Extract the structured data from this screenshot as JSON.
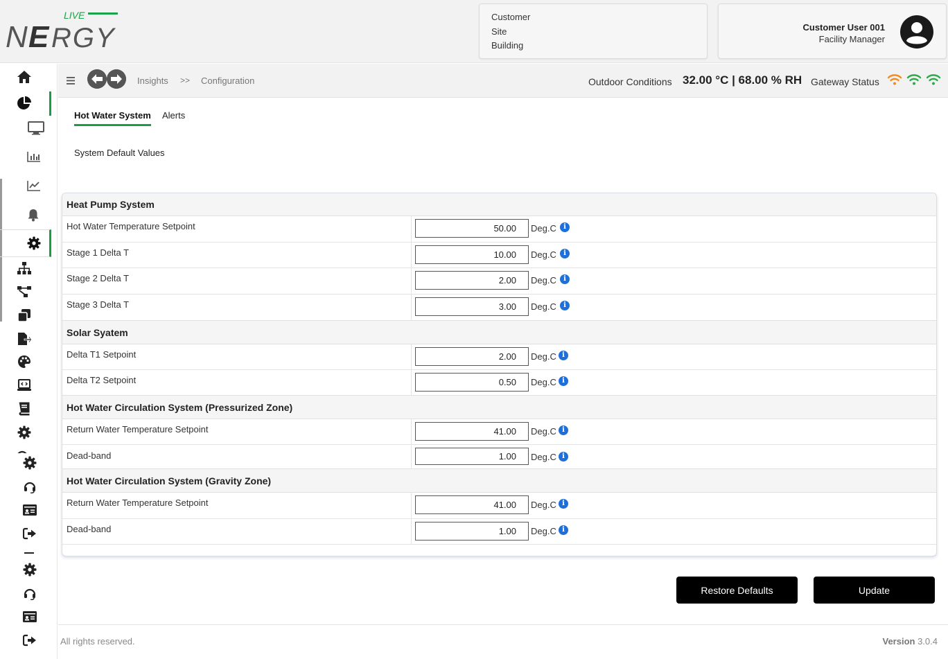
{
  "logo": {
    "main": "NERGY",
    "sup": "LIVE"
  },
  "location": {
    "customer": "Customer",
    "site": "Site",
    "building": "Building"
  },
  "user": {
    "name": "Customer User 001",
    "role": "Facility Manager"
  },
  "breadcrumb": {
    "first": "Insights",
    "separator": ">>",
    "second": "Configuration"
  },
  "outdoor": {
    "label": "Outdoor Conditions",
    "value": "32.00 °C | 68.00 % RH"
  },
  "gateway": {
    "label": "Gateway Status",
    "colors": [
      "#f28c1e",
      "#2bab4a",
      "#2bab4a"
    ]
  },
  "tabs": {
    "hot_water": "Hot Water System",
    "alerts": "Alerts"
  },
  "system_defaults_label": "System Default Values",
  "sections": [
    {
      "title": "Heat Pump System",
      "rows": [
        {
          "label": "Hot Water Temperature Setpoint",
          "value": "50.00",
          "unit": "Deg.C"
        },
        {
          "label": "Stage 1 Delta T",
          "value": "10.00",
          "unit": "Deg.C"
        },
        {
          "label": "Stage 2 Delta T",
          "value": "2.00",
          "unit": "Deg.C"
        },
        {
          "label": "Stage 3 Delta T",
          "value": "3.00",
          "unit": "Deg.C"
        }
      ]
    },
    {
      "title": "Solar Syatem",
      "rows": [
        {
          "label": "Delta T1 Setpoint",
          "value": "2.00",
          "unit": "Deg.C"
        },
        {
          "label": "Delta T2 Setpoint",
          "value": "0.50",
          "unit": "Deg.C"
        }
      ]
    },
    {
      "title": "Hot Water Circulation System (Pressurized Zone)",
      "rows": [
        {
          "label": "Return Water Temperature Setpoint",
          "value": "41.00",
          "unit": "Deg.C"
        },
        {
          "label": "Dead-band",
          "value": "1.00",
          "unit": "Deg.C"
        }
      ]
    },
    {
      "title": "Hot Water Circulation System (Gravity Zone)",
      "rows": [
        {
          "label": "Return Water Temperature Setpoint",
          "value": "41.00",
          "unit": "Deg.C"
        },
        {
          "label": "Dead-band",
          "value": "1.00",
          "unit": "Deg.C"
        }
      ]
    }
  ],
  "info_glyph": "i",
  "buttons": {
    "restore": "Restore Defaults",
    "update": "Update"
  },
  "footer": {
    "rights": "All rights reserved.",
    "version_label": "Version",
    "version_value": "3.0.4"
  },
  "sidebar_icons": [
    "home-icon",
    "pie-chart-icon",
    "monitor-icon",
    "bar-chart-icon",
    "trend-chart-icon",
    "bell-icon",
    "gear-icon",
    "sitemap-icon",
    "workflow-icon",
    "copy-icon",
    "file-export-icon",
    "palette-icon",
    "laptop-code-icon",
    "book-icon",
    "cog-icon",
    "headset-icon",
    "id-card-icon",
    "logout-icon"
  ]
}
